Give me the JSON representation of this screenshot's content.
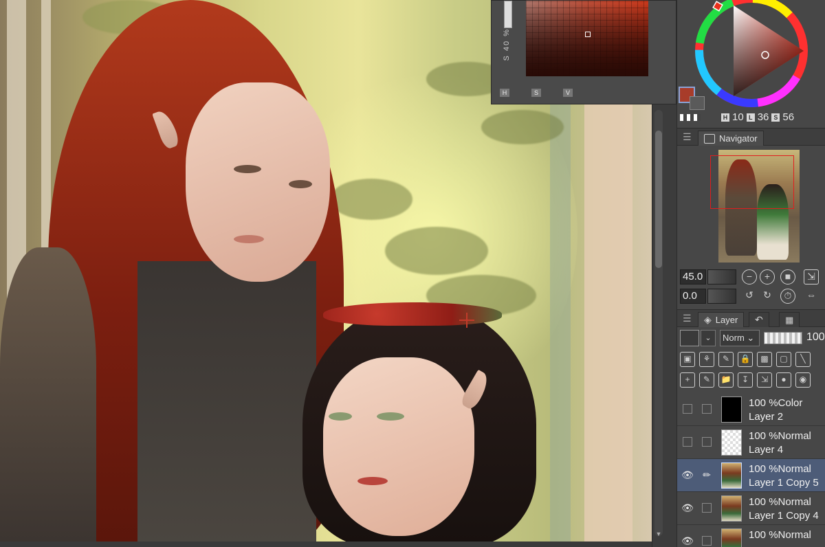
{
  "color_panel": {
    "side_labels": "S  40 %",
    "tabs": [
      "H",
      "S",
      "V"
    ]
  },
  "color_wheel": {
    "readout": {
      "h_tag": "H",
      "h_value": "10",
      "l_tag": "L",
      "l_value": "36",
      "s_tag": "S",
      "s_value": "56"
    },
    "main_color": "#a83c2a"
  },
  "navigator": {
    "tab_label": "Navigator",
    "zoom_value": "45.0",
    "rotation_value": "0.0"
  },
  "layer_panel": {
    "tab_label": "Layer",
    "blend_mode": "Norm",
    "opacity": "100",
    "layers": [
      {
        "line1": "100 %Color",
        "line2": "Layer 2",
        "visible": false,
        "thumb": "black"
      },
      {
        "line1": "100 %Normal",
        "line2": "Layer 4",
        "visible": false,
        "thumb": "transparent"
      },
      {
        "line1": "100 %Normal",
        "line2": "Layer 1 Copy 5",
        "visible": true,
        "selected": true,
        "thumb": "art"
      },
      {
        "line1": "100 %Normal",
        "line2": "Layer 1 Copy 4",
        "visible": true,
        "thumb": "art"
      },
      {
        "line1": "100 %Normal",
        "line2": "",
        "visible": true,
        "thumb": "art"
      }
    ]
  },
  "colors": {
    "panel_bg": "#474747",
    "selected_row": "#4d5c78",
    "navigator_frame": "#e21d1d"
  }
}
